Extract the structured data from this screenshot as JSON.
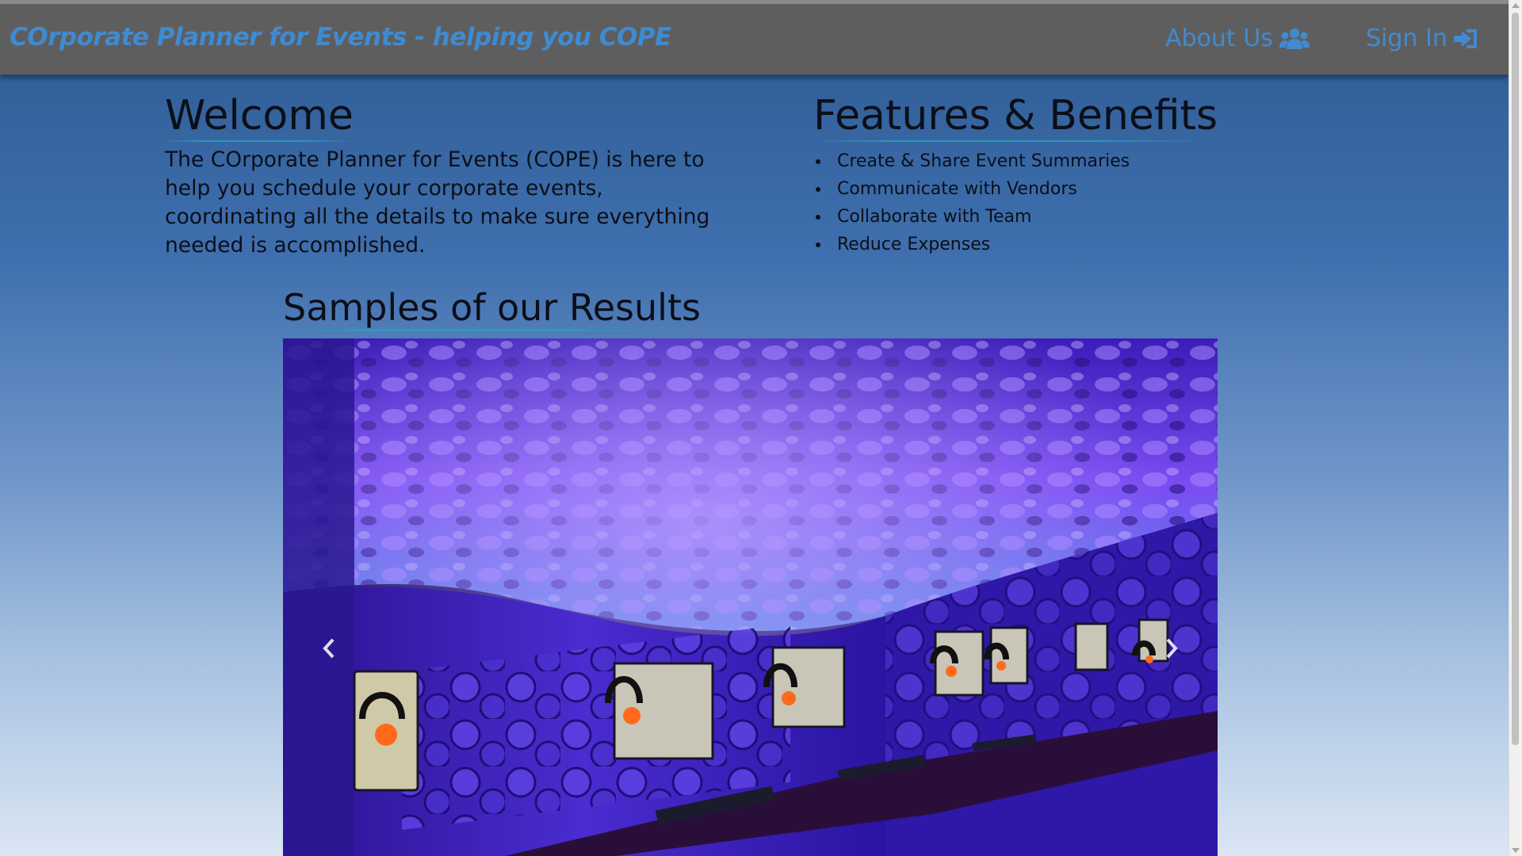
{
  "navbar": {
    "brand": "COrporate Planner for Events - helping you COPE",
    "about_label": "About Us",
    "about_icon": "users-icon",
    "signin_label": "Sign In",
    "signin_icon": "sign-in-icon",
    "brand_color": "#3f8bd1",
    "background": "#5f5e5f"
  },
  "welcome": {
    "heading": "Welcome",
    "text": "The COrporate Planner for Events (COPE) is here to help you schedule your corporate events, coordinating all the details to make sure everything needed is accomplished."
  },
  "features": {
    "heading": "Features & Benefits",
    "items": [
      "Create & Share Event Summaries",
      "Communicate with Vendors",
      "Collaborate with Team",
      "Reduce Expenses"
    ]
  },
  "samples": {
    "heading": "Samples of our Results",
    "prev_icon": "chevron-left-icon",
    "next_icon": "chevron-right-icon"
  }
}
